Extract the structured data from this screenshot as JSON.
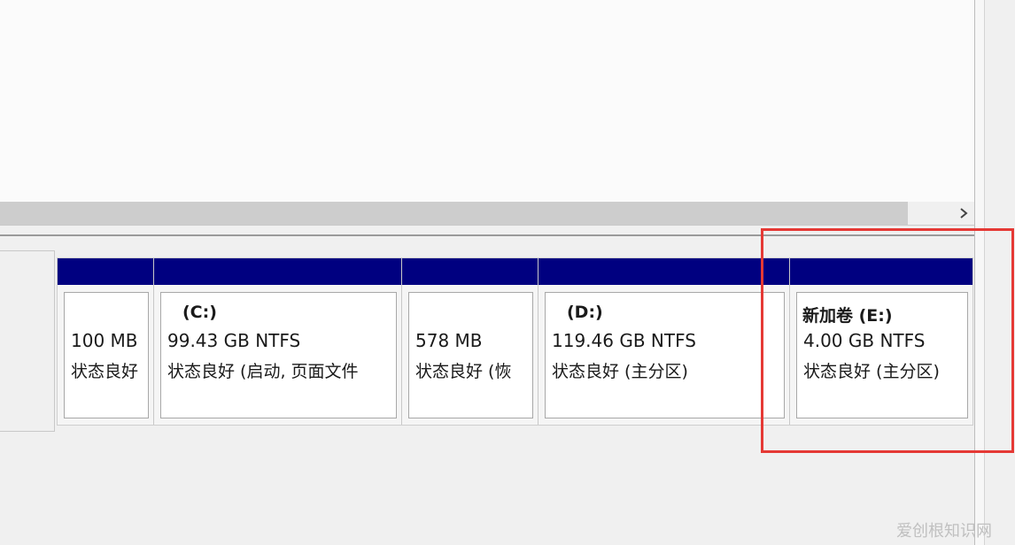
{
  "scrollbar": {
    "right_arrow_icon": "chevron-right-icon"
  },
  "partitions": [
    {
      "name": "",
      "size": "100 MB",
      "status": "状态良好"
    },
    {
      "name": "(C:)",
      "size": "99.43 GB NTFS",
      "status": "状态良好 (启动, 页面文件"
    },
    {
      "name": "",
      "size": "578 MB",
      "status": "状态良好 (恢"
    },
    {
      "name": "(D:)",
      "size": "119.46 GB NTFS",
      "status": "状态良好 (主分区)"
    },
    {
      "name": "新加卷  (E:)",
      "size": "4.00 GB NTFS",
      "status": "状态良好 (主分区)"
    }
  ],
  "colors": {
    "partition_header": "#000080",
    "highlight_box": "#e53935"
  },
  "watermark": "爱创根知识网"
}
